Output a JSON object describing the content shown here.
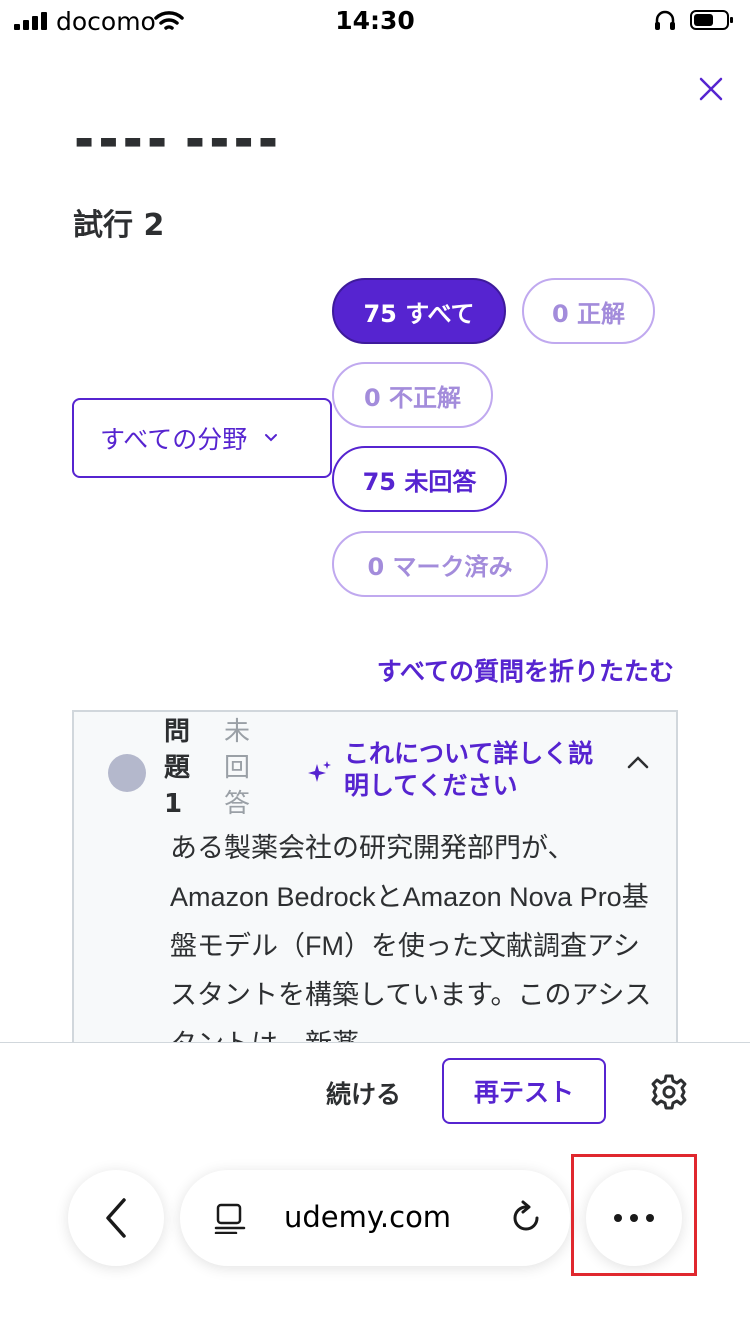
{
  "status_bar": {
    "carrier": "docomo",
    "time": "14:30"
  },
  "page": {
    "attempt_title": "試行 2",
    "area_dropdown_label": "すべての分野",
    "filters": {
      "all": "75 すべて",
      "correct": "0 正解",
      "incorrect": "0 不正解",
      "unanswered": "75 未回答",
      "marked": "0 マーク済み"
    },
    "collapse_all": "すべての質問を折りたたむ",
    "question": {
      "label": "問題 1",
      "status": "未回答",
      "explain_link": "これについて詳しく説明してください",
      "text": "ある製薬会社の研究開発部門が、Amazon BedrockとAmazon Nova Pro基盤モデル（FM）を使った文献調査アシスタントを構築しています。このアシスタントは、新薬"
    }
  },
  "action_bar": {
    "continue": "続ける",
    "retest": "再テスト"
  },
  "browser": {
    "url": "udemy.com"
  },
  "colors": {
    "accent": "#5624d0",
    "highlight": "#e0282e"
  }
}
